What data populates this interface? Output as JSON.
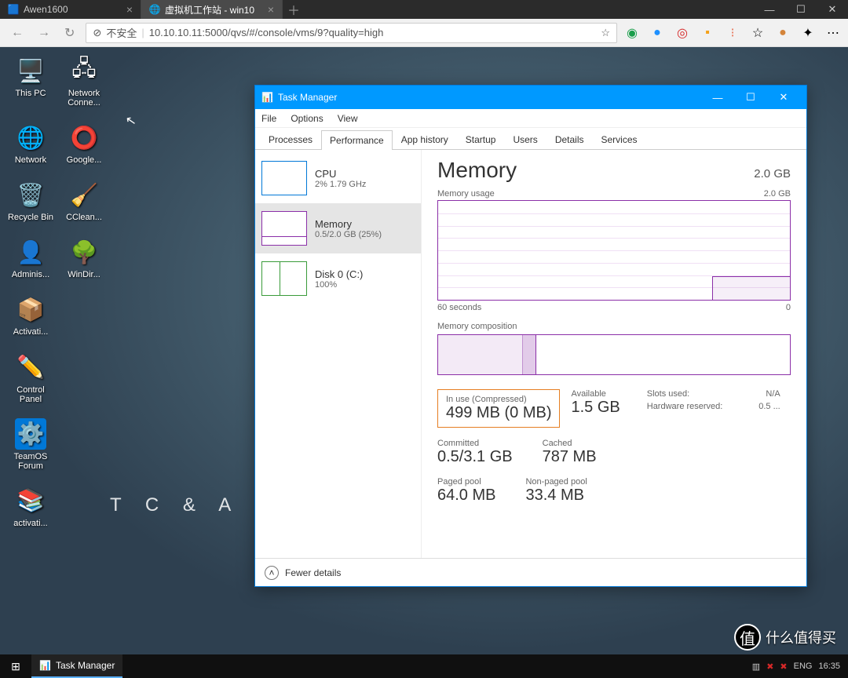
{
  "browser": {
    "tabs": [
      {
        "title": "Awen1600",
        "favicon": "🟦"
      },
      {
        "title": "虚拟机工作站 - win10",
        "favicon": "🌐"
      }
    ],
    "insecure_label": "不安全",
    "url": "10.10.10.11:5000/qvs/#/console/vms/9?quality=high"
  },
  "desktop_icons": [
    {
      "label": "This PC",
      "glyph": "🖥️"
    },
    {
      "label": "Network Conne...",
      "glyph": "🖧"
    },
    {
      "label": "Network",
      "glyph": "🌐"
    },
    {
      "label": "Google...",
      "glyph": "⭕"
    },
    {
      "label": "Recycle Bin",
      "glyph": "🗑️"
    },
    {
      "label": "CClean...",
      "glyph": "🧹"
    },
    {
      "label": "Adminis...",
      "glyph": "👤"
    },
    {
      "label": "WinDir...",
      "glyph": "🌳"
    },
    {
      "label": "Activati...",
      "glyph": "📦"
    },
    {
      "label": "",
      "glyph": ""
    },
    {
      "label": "Control Panel",
      "glyph": "✏️"
    },
    {
      "label": "",
      "glyph": ""
    },
    {
      "label": "TeamOS Forum",
      "glyph": "⚙️"
    },
    {
      "label": "",
      "glyph": ""
    },
    {
      "label": "activati...",
      "glyph": "📚"
    }
  ],
  "watermark": "T C & A X E",
  "watermark2": "什么值得买",
  "task_manager": {
    "title": "Task Manager",
    "menu": [
      "File",
      "Options",
      "View"
    ],
    "tabs": [
      "Processes",
      "Performance",
      "App history",
      "Startup",
      "Users",
      "Details",
      "Services"
    ],
    "active_tab": "Performance",
    "side": {
      "cpu": {
        "title": "CPU",
        "sub": "2%  1.79 GHz"
      },
      "mem": {
        "title": "Memory",
        "sub": "0.5/2.0 GB (25%)"
      },
      "disk": {
        "title": "Disk 0 (C:)",
        "sub": "100%"
      }
    },
    "main": {
      "heading": "Memory",
      "capacity": "2.0 GB",
      "usage_label": "Memory usage",
      "usage_max": "2.0 GB",
      "axis_left": "60 seconds",
      "axis_right": "0",
      "composition_label": "Memory composition",
      "stats": {
        "in_use_l": "In use (Compressed)",
        "in_use_v": "499 MB (0 MB)",
        "avail_l": "Available",
        "avail_v": "1.5 GB",
        "commit_l": "Committed",
        "commit_v": "0.5/3.1 GB",
        "cached_l": "Cached",
        "cached_v": "787 MB",
        "paged_l": "Paged pool",
        "paged_v": "64.0 MB",
        "nonpaged_l": "Non-paged pool",
        "nonpaged_v": "33.4 MB",
        "slots_l": "Slots used:",
        "slots_v": "N/A",
        "hw_l": "Hardware reserved:",
        "hw_v": "0.5 ..."
      }
    },
    "footer": "Fewer details"
  },
  "taskbar": {
    "app": "Task Manager",
    "lang": "ENG",
    "time": "16:35"
  },
  "chart_data": {
    "type": "line",
    "title": "Memory usage",
    "xlabel": "seconds ago",
    "ylabel": "GB",
    "ylim": [
      0,
      2.0
    ],
    "x": [
      60,
      50,
      40,
      30,
      20,
      15,
      10,
      5,
      0
    ],
    "values": [
      0,
      0,
      0,
      0,
      0,
      0,
      0.5,
      0.5,
      0.5
    ],
    "annotations": [
      "steps from 0 to ~0.5 GB near right edge"
    ]
  }
}
